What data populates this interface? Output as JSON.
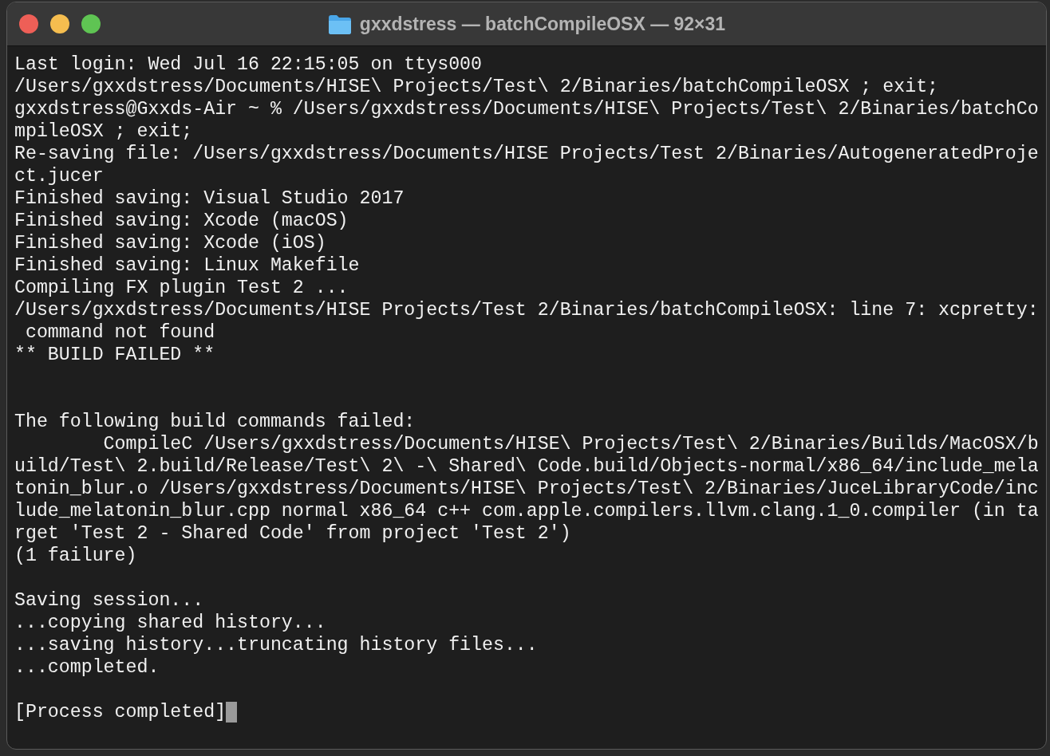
{
  "window": {
    "title": "gxxdstress — batchCompileOSX — 92×31"
  },
  "lines": [
    {
      "kind": "text",
      "text": "Last login: Wed Jul 16 22:15:05 on ttys000"
    },
    {
      "kind": "text",
      "text": "/Users/gxxdstress/Documents/HISE\\ Projects/Test\\ 2/Binaries/batchCompileOSX ; exit;"
    },
    {
      "kind": "text",
      "text": "gxxdstress@Gxxds-Air ~ % /Users/gxxdstress/Documents/HISE\\ Projects/Test\\ 2/Binaries/batchCo"
    },
    {
      "kind": "text",
      "text": "mpileOSX ; exit;"
    },
    {
      "kind": "text",
      "text": "Re-saving file: /Users/gxxdstress/Documents/HISE Projects/Test 2/Binaries/AutogeneratedProje"
    },
    {
      "kind": "text",
      "text": "ct.jucer"
    },
    {
      "kind": "text",
      "text": "Finished saving: Visual Studio 2017"
    },
    {
      "kind": "text",
      "text": "Finished saving: Xcode (macOS)"
    },
    {
      "kind": "text",
      "text": "Finished saving: Xcode (iOS)"
    },
    {
      "kind": "text",
      "text": "Finished saving: Linux Makefile"
    },
    {
      "kind": "text",
      "text": "Compiling FX plugin Test 2 ..."
    },
    {
      "kind": "text",
      "text": "/Users/gxxdstress/Documents/HISE Projects/Test 2/Binaries/batchCompileOSX: line 7: xcpretty:"
    },
    {
      "kind": "text",
      "text": " command not found"
    },
    {
      "kind": "text",
      "text": "** BUILD FAILED **"
    },
    {
      "kind": "blank"
    },
    {
      "kind": "blank"
    },
    {
      "kind": "text",
      "text": "The following build commands failed:"
    },
    {
      "kind": "text",
      "text": "        CompileC /Users/gxxdstress/Documents/HISE\\ Projects/Test\\ 2/Binaries/Builds/MacOSX/b"
    },
    {
      "kind": "text",
      "text": "uild/Test\\ 2.build/Release/Test\\ 2\\ -\\ Shared\\ Code.build/Objects-normal/x86_64/include_mela"
    },
    {
      "kind": "text",
      "text": "tonin_blur.o /Users/gxxdstress/Documents/HISE\\ Projects/Test\\ 2/Binaries/JuceLibraryCode/inc"
    },
    {
      "kind": "text",
      "text": "lude_melatonin_blur.cpp normal x86_64 c++ com.apple.compilers.llvm.clang.1_0.compiler (in ta"
    },
    {
      "kind": "text",
      "text": "rget 'Test 2 - Shared Code' from project 'Test 2')"
    },
    {
      "kind": "text",
      "text": "(1 failure)"
    },
    {
      "kind": "blank"
    },
    {
      "kind": "text",
      "text": "Saving session..."
    },
    {
      "kind": "text",
      "text": "...copying shared history..."
    },
    {
      "kind": "text",
      "text": "...saving history...truncating history files..."
    },
    {
      "kind": "text",
      "text": "...completed."
    },
    {
      "kind": "blank"
    },
    {
      "kind": "text",
      "text": "[Process completed]",
      "cursor": true
    }
  ]
}
